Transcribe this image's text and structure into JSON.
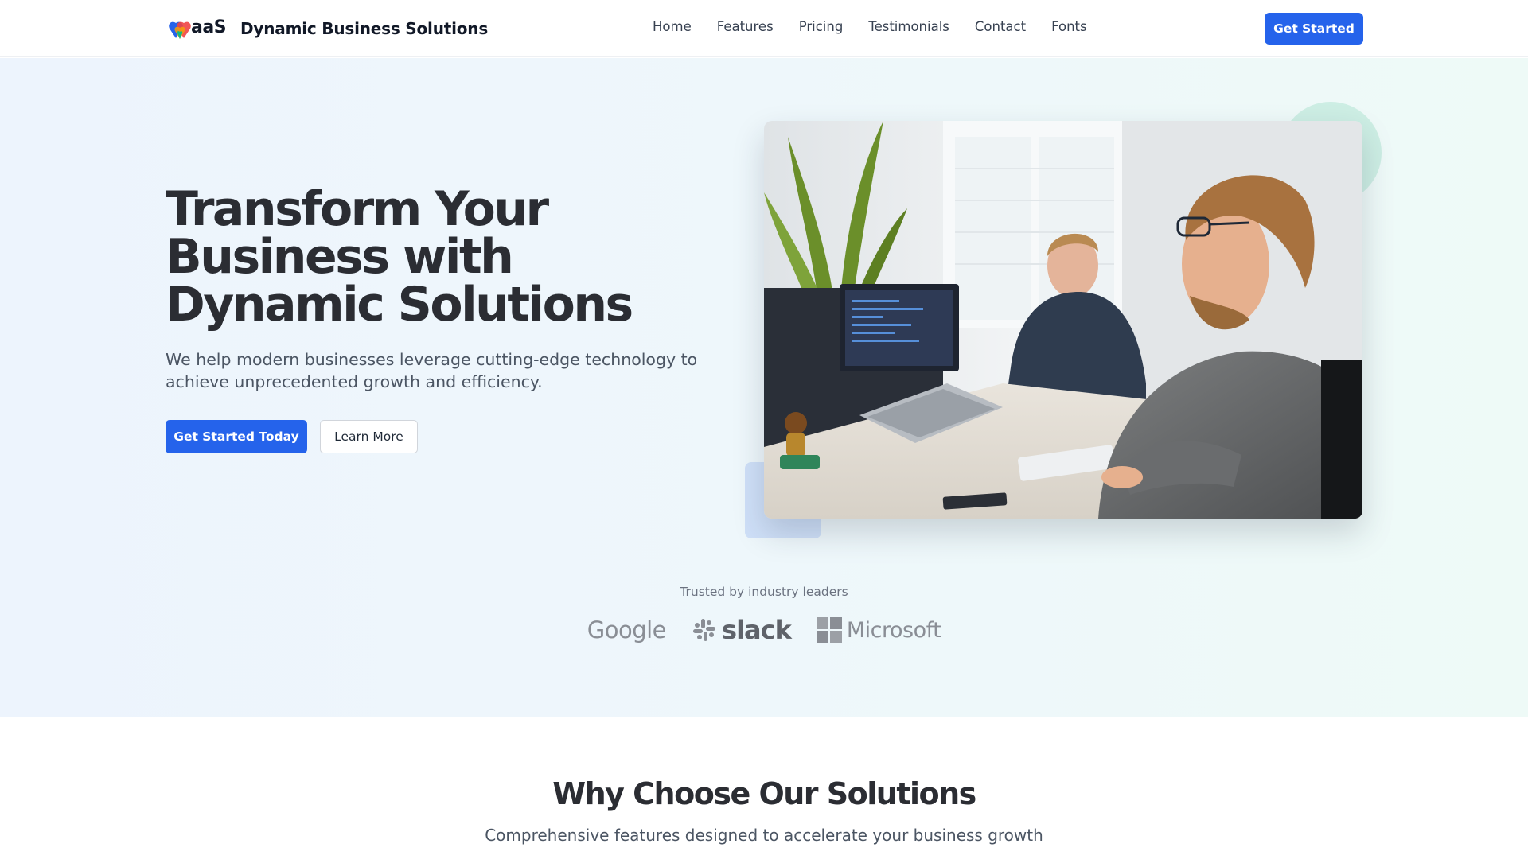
{
  "nav": {
    "logo_text": "aaS",
    "brand_name": "Dynamic Business Solutions",
    "links": [
      {
        "label": "Home"
      },
      {
        "label": "Features"
      },
      {
        "label": "Pricing"
      },
      {
        "label": "Testimonials"
      },
      {
        "label": "Contact"
      },
      {
        "label": "Fonts"
      }
    ],
    "cta_label": "Get Started"
  },
  "hero": {
    "title": "Transform Your Business with Dynamic Solutions",
    "subtitle": "We help modern businesses leverage cutting-edge technology to achieve unprecedented growth and efficiency.",
    "primary_button": "Get Started Today",
    "secondary_button": "Learn More"
  },
  "trusted": {
    "label": "Trusted by industry leaders",
    "partners": [
      {
        "name": "Google",
        "icon": "google-logo"
      },
      {
        "name": "slack",
        "icon": "slack-logo"
      },
      {
        "name": "Microsoft",
        "icon": "microsoft-logo"
      }
    ]
  },
  "features_section": {
    "title": "Why Choose Our Solutions",
    "subtitle": "Comprehensive features designed to accelerate your business growth"
  },
  "colors": {
    "accent": "#2563eb",
    "hero_bg_start": "#edf4fd",
    "hero_bg_end": "#eefaf7",
    "heading": "#2b2d33"
  }
}
